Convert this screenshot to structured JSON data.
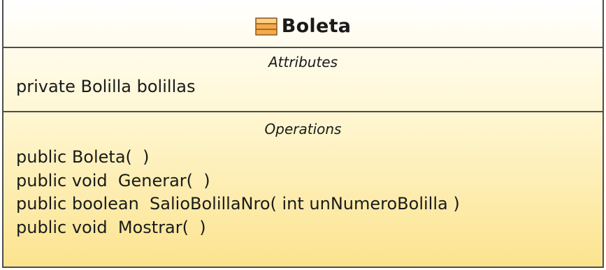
{
  "class_box": {
    "name": "Boleta",
    "icon": "uml-class-icon",
    "colors": {
      "border": "#4d4d4d",
      "fill_top": "#ffffff",
      "fill_bottom": "#fbe38e",
      "icon_fill": "#f5a94a"
    },
    "attributes": {
      "title": "Attributes",
      "items": [
        "private Bolilla bolillas"
      ]
    },
    "operations": {
      "title": "Operations",
      "items": [
        "public Boleta(  )",
        "public void  Generar(  )",
        "public boolean  SalioBolillaNro( int unNumeroBolilla )",
        "public void  Mostrar(  )"
      ]
    }
  }
}
